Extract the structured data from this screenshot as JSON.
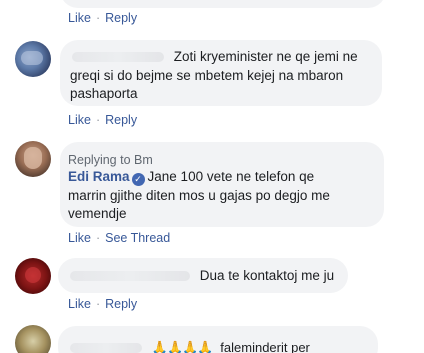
{
  "actions": {
    "like": "Like",
    "reply": "Reply",
    "see_thread": "See Thread",
    "separator": "·"
  },
  "comments": [
    {
      "text": "Zoti kryeminister ne qe jemi ne greqi si do bejme se mbetem kejej na mbaron pashaporta",
      "line1": "Zoti kryeminister ne qe jemi ne",
      "line2": "greqi si do bejme se mbetem kejej na mbaron",
      "line3": "pashaporta"
    },
    {
      "replying_to": "Replying to Bm",
      "author": "Edi Rama",
      "line1": "Jane 100 vete ne telefon qe",
      "line2": "marrin gjithe diten mos u gajas po degjo me",
      "line3": "vemendje"
    },
    {
      "text": "Dua te kontaktoj me ju"
    },
    {
      "emojis": "🙏🙏🙏🙏",
      "text": "faleminderit per"
    }
  ],
  "colors": {
    "link": "#385898",
    "bubble": "#f2f3f5",
    "verified": "#4267b2"
  }
}
